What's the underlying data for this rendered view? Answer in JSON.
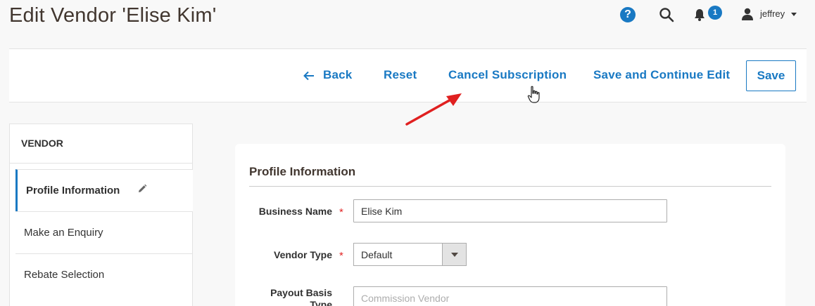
{
  "header": {
    "title": "Edit Vendor 'Elise Kim'",
    "help_symbol": "?",
    "notification_count": "1",
    "user_name": "jeffrey"
  },
  "action_bar": {
    "back_label": "Back",
    "reset_label": "Reset",
    "cancel_subscription_label": "Cancel Subscription",
    "save_continue_label": "Save and Continue Edit",
    "save_label": "Save"
  },
  "sidebar": {
    "heading": "VENDOR",
    "items": [
      {
        "label": "Profile Information",
        "active": true
      },
      {
        "label": "Make an Enquiry",
        "active": false
      },
      {
        "label": "Rebate Selection",
        "active": false
      }
    ]
  },
  "main": {
    "section_title": "Profile Information",
    "fields": {
      "business_name": {
        "label": "Business Name",
        "required": "*",
        "value": "Elise Kim"
      },
      "vendor_type": {
        "label": "Vendor Type",
        "required": "*",
        "value": "Default"
      },
      "payout_basis": {
        "label": "Payout Basis Type",
        "placeholder": "Commission Vendor"
      }
    }
  },
  "colors": {
    "accent": "#1979c3",
    "required": "#e22626",
    "annotation_arrow": "#e02020"
  },
  "icons": [
    "help-icon",
    "search-icon",
    "bell-icon",
    "user-icon",
    "back-arrow-icon",
    "pencil-icon",
    "chevron-down-icon",
    "hand-cursor-icon"
  ]
}
